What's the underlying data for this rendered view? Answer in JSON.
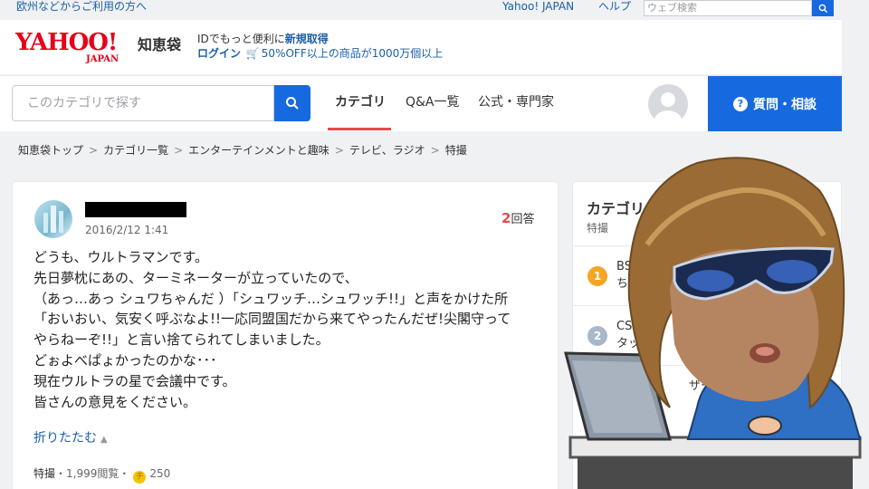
{
  "topbar": {
    "region_link": "欧州などからご利用の方へ",
    "yahoo_japan_link": "Yahoo! JAPAN",
    "help_link": "ヘルプ",
    "web_search_placeholder": "ウェブ検索"
  },
  "brand": {
    "logo_text": "YAHOO!",
    "logo_japan": "JAPAN",
    "service_name": "知恵袋",
    "id_prefix": "IDでもっと便利に",
    "id_link": "新規取得",
    "login_link": "ログイン",
    "promo_text": "50%OFF以上の商品が1000万個以上"
  },
  "nav": {
    "category_search_placeholder": "このカテゴリで探す",
    "tabs": [
      {
        "label": "カテゴリ"
      },
      {
        "label": "Q&A一覧"
      },
      {
        "label": "公式・専門家"
      }
    ],
    "ask_button": "質問・相談"
  },
  "breadcrumb": [
    "知恵袋トップ",
    "カテゴリ一覧",
    "エンターテインメントと趣味",
    "テレビ、ラジオ",
    "特撮"
  ],
  "question": {
    "date": "2016/2/12 1:41",
    "answer_count": "2",
    "answer_suffix": "回答",
    "lines": [
      "どうも、ウルトラマンです。",
      "先日夢枕にあの、ターミネーターが立っていたので、",
      "（あっ…あっ シュワちゃんだ ）「シュワッチ…シュワッチ!!」と声をかけた所",
      "「おいおい、気安く呼ぶなよ!!一応同盟国だから来てやったんだぜ!尖閣守って",
      "やらねーぞ!!」と言い捨てられてしまいました。",
      "どぉよべぱょかったのかな･･･",
      "現在ウルトラの星で会議中です。",
      "皆さんの意見をください。"
    ],
    "fold_label": "折りたたむ",
    "meta_category": "特撮",
    "meta_views": "・1,999閲覧・",
    "coin_symbol": "チ",
    "coin_amount": "250"
  },
  "panel": {
    "title": "カテゴリ",
    "subtitle": "特撮",
    "ranks": [
      {
        "num": "1",
        "text1": "BS",
        "text2": "ちゃ"
      },
      {
        "num": "2",
        "text1": "CSM",
        "text2": "タッチ"
      }
    ],
    "partial_text": "ザー"
  },
  "colors": {
    "accent_blue": "#1769e0",
    "link_blue": "#1a5fa8",
    "yahoo_red": "#e60019",
    "rank_gold": "#f5a623",
    "rank_silver": "#a9b8c9"
  }
}
